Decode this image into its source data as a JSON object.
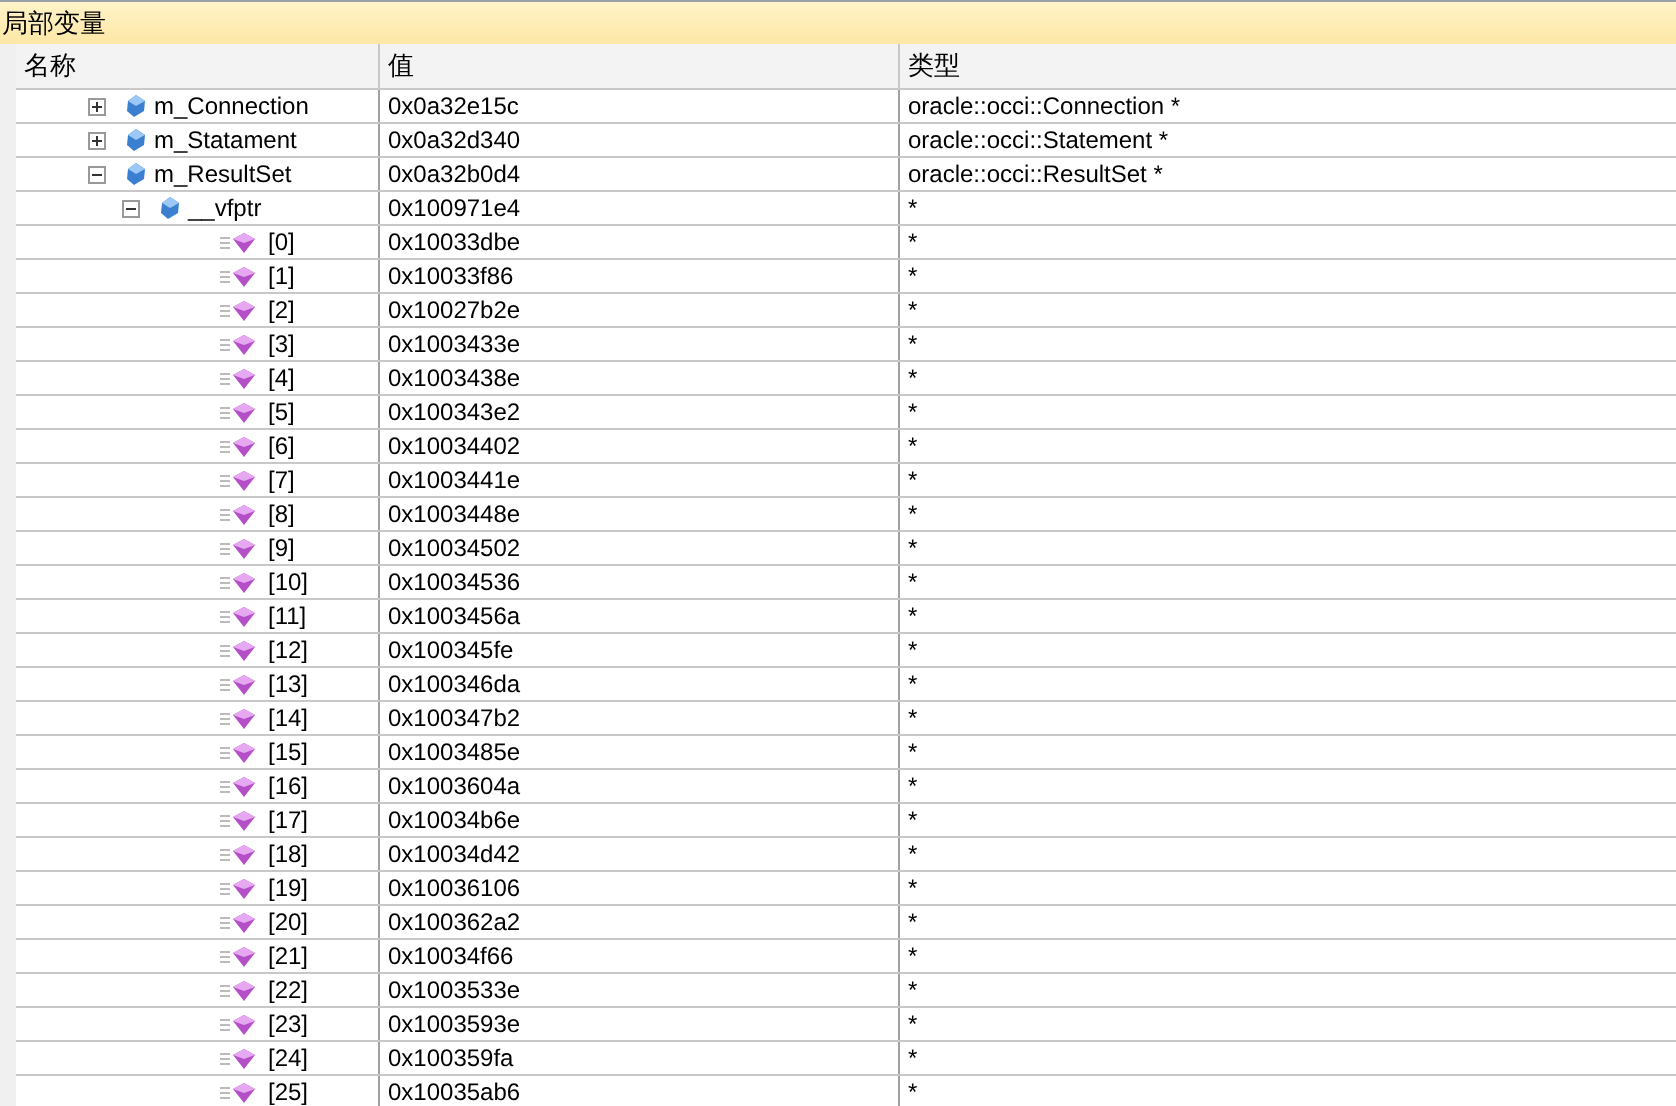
{
  "panel": {
    "title": "局部变量"
  },
  "table": {
    "columns": [
      "名称",
      "值",
      "类型"
    ],
    "rows": [
      {
        "name": "m_Connection",
        "value": "0x0a32e15c",
        "type": "oracle::occi::Connection *",
        "kind": "member",
        "expanded": false
      },
      {
        "name": "m_Statament",
        "value": "0x0a32d340",
        "type": "oracle::occi::Statement *",
        "kind": "member",
        "expanded": false
      },
      {
        "name": "m_ResultSet",
        "value": "0x0a32b0d4",
        "type": "oracle::occi::ResultSet *",
        "kind": "member",
        "expanded": true,
        "children": [
          {
            "name": "__vfptr",
            "value": "0x100971e4",
            "type": "*",
            "kind": "member",
            "expanded": true,
            "children": [
              {
                "name": "[0]",
                "value": "0x10033dbe",
                "type": "*",
                "kind": "method"
              },
              {
                "name": "[1]",
                "value": "0x10033f86",
                "type": "*",
                "kind": "method"
              },
              {
                "name": "[2]",
                "value": "0x10027b2e",
                "type": "*",
                "kind": "method"
              },
              {
                "name": "[3]",
                "value": "0x1003433e",
                "type": "*",
                "kind": "method"
              },
              {
                "name": "[4]",
                "value": "0x1003438e",
                "type": "*",
                "kind": "method"
              },
              {
                "name": "[5]",
                "value": "0x100343e2",
                "type": "*",
                "kind": "method"
              },
              {
                "name": "[6]",
                "value": "0x10034402",
                "type": "*",
                "kind": "method"
              },
              {
                "name": "[7]",
                "value": "0x1003441e",
                "type": "*",
                "kind": "method"
              },
              {
                "name": "[8]",
                "value": "0x1003448e",
                "type": "*",
                "kind": "method"
              },
              {
                "name": "[9]",
                "value": "0x10034502",
                "type": "*",
                "kind": "method"
              },
              {
                "name": "[10]",
                "value": "0x10034536",
                "type": "*",
                "kind": "method"
              },
              {
                "name": "[11]",
                "value": "0x1003456a",
                "type": "*",
                "kind": "method"
              },
              {
                "name": "[12]",
                "value": "0x100345fe",
                "type": "*",
                "kind": "method"
              },
              {
                "name": "[13]",
                "value": "0x100346da",
                "type": "*",
                "kind": "method"
              },
              {
                "name": "[14]",
                "value": "0x100347b2",
                "type": "*",
                "kind": "method"
              },
              {
                "name": "[15]",
                "value": "0x1003485e",
                "type": "*",
                "kind": "method"
              },
              {
                "name": "[16]",
                "value": "0x1003604a",
                "type": "*",
                "kind": "method"
              },
              {
                "name": "[17]",
                "value": "0x10034b6e",
                "type": "*",
                "kind": "method"
              },
              {
                "name": "[18]",
                "value": "0x10034d42",
                "type": "*",
                "kind": "method"
              },
              {
                "name": "[19]",
                "value": "0x10036106",
                "type": "*",
                "kind": "method"
              },
              {
                "name": "[20]",
                "value": "0x100362a2",
                "type": "*",
                "kind": "method"
              },
              {
                "name": "[21]",
                "value": "0x10034f66",
                "type": "*",
                "kind": "method"
              },
              {
                "name": "[22]",
                "value": "0x1003533e",
                "type": "*",
                "kind": "method"
              },
              {
                "name": "[23]",
                "value": "0x1003593e",
                "type": "*",
                "kind": "method"
              },
              {
                "name": "[24]",
                "value": "0x100359fa",
                "type": "*",
                "kind": "method"
              },
              {
                "name": "[25]",
                "value": "0x10035ab6",
                "type": "*",
                "kind": "method"
              }
            ]
          }
        ]
      }
    ]
  }
}
